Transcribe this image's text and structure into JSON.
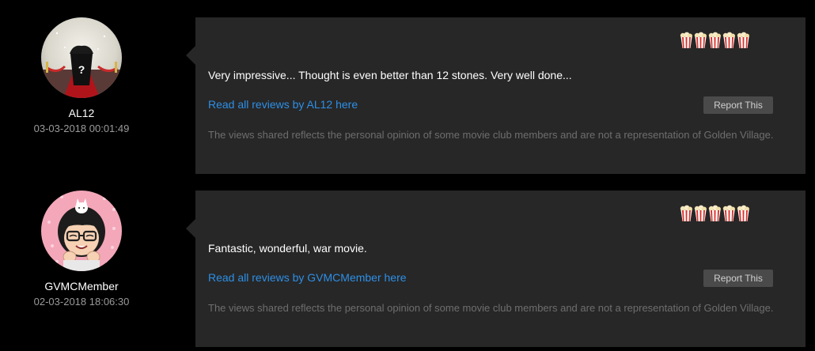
{
  "reviews": [
    {
      "username": "AL12",
      "timestamp": "03-03-2018 00:01:49",
      "rating": 5,
      "comment": "Very impressive... Thought is even better than 12 stones. Very well done...",
      "read_link": "Read all reviews by AL12 here",
      "report_label": "Report This",
      "disclaimer": "The views shared reflects the personal opinion of some movie club members and are not a representation of Golden Village.",
      "avatar_icon": "mystery-popcorn-avatar-icon"
    },
    {
      "username": "GVMCMember",
      "timestamp": "02-03-2018 18:06:30",
      "rating": 5,
      "comment": "Fantastic, wonderful, war movie.",
      "read_link": "Read all reviews by GVMCMember here",
      "report_label": "Report This",
      "disclaimer": "The views shared reflects the personal opinion of some movie club members and are not a representation of Golden Village.",
      "avatar_icon": "cartoon-member-avatar-icon"
    }
  ],
  "colors": {
    "background": "#000000",
    "card": "#272727",
    "link": "#2d8fe6",
    "popcorn_red": "#d8322b"
  }
}
